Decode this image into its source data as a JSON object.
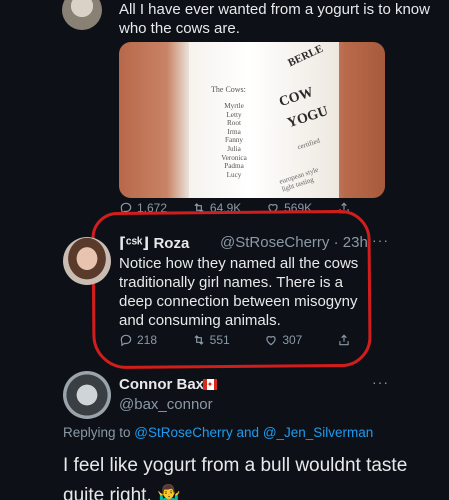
{
  "tweet1": {
    "text": "All I have ever wanted from a yogurt is to know who the cows are.",
    "image": {
      "cows_label": "The Cows:",
      "cows_list": "Myrtle\nLetty\nRoot\nIrma\nFanny\nJulia\nVeronica\nPadma\nLucy",
      "brand_text": "BERLE",
      "product_line1": "COW",
      "product_line2": "YOGU",
      "certified_text": "certified",
      "euro_text": "european style\nlight tasting"
    },
    "actions": {
      "replies": "1,672",
      "retweets": "64.9K",
      "likes": "569K"
    }
  },
  "tweet2": {
    "name": "⌈ᶜˢᵏ⌋ Roza",
    "handle_time": "@StRoseCherry · 23h",
    "more": "···",
    "text": "Notice how they named all the cows traditionally girl names. There is a deep connection between misogyny and consuming animals.",
    "actions": {
      "replies": "218",
      "retweets": "551",
      "likes": "307"
    },
    "annotation_color": "#d21d1d"
  },
  "tweet3": {
    "name": "Connor Bax",
    "handle": "@bax_connor",
    "more": "···",
    "replying_prefix": "Replying to ",
    "replying_user1": "@StRoseCherry",
    "replying_and": " and ",
    "replying_user2": "@_Jen_Silverman",
    "text": "I feel like yogurt from a bull wouldnt taste quite right. 🤷‍♂️"
  },
  "colors": {
    "background": "#0d1117",
    "text_primary": "#e7e9ea",
    "text_secondary": "#8b98a5",
    "link": "#1d9bf0"
  }
}
